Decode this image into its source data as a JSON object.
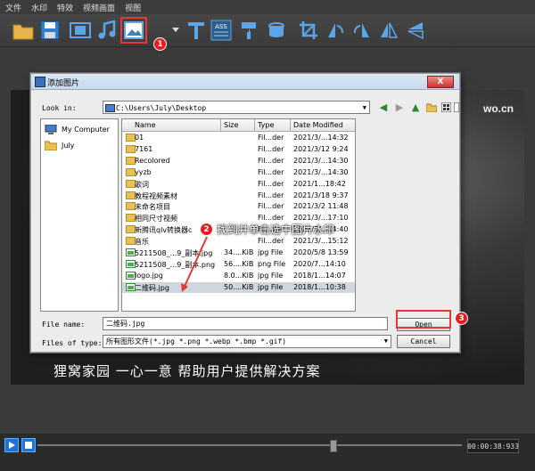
{
  "menu": [
    "文件",
    "水印",
    "特效",
    "视频画面",
    "视图"
  ],
  "toolbar": {
    "icons": [
      "folder-icon",
      "save-icon",
      "video-strip-icon",
      "music-icon",
      "image-icon",
      "dropdown-arrow-icon",
      "text-icon",
      "ass-subtitle-icon",
      "brush-icon",
      "bucket-icon",
      "crop-icon",
      "rotate-left-icon",
      "rotate-right-icon",
      "flip-horizontal-icon",
      "flip-vertical-icon"
    ],
    "ass_label": "ASS",
    "step1": "1"
  },
  "video": {
    "watermark": "wo.cn",
    "caption": "狸窝家园 一心一意 帮助用户提供解决方案"
  },
  "dialog": {
    "title": "添加图片",
    "close": "X",
    "look_in_label": "Look in:",
    "look_in_value": "C:\\Users\\July\\Desktop",
    "places": [
      "My Computer",
      "July"
    ],
    "columns": [
      "Name",
      "Size",
      "Type",
      "Date Modified"
    ],
    "files": [
      {
        "name": "01",
        "size": "",
        "type": "Fil...der",
        "date": "2021/3/...14:32",
        "kind": "folder"
      },
      {
        "name": "7161",
        "size": "",
        "type": "Fil...der",
        "date": "2021/3/12 9:24",
        "kind": "folder"
      },
      {
        "name": "Recolored",
        "size": "",
        "type": "Fil...der",
        "date": "2021/3/...14:30",
        "kind": "folder"
      },
      {
        "name": "yyzb",
        "size": "",
        "type": "Fil...der",
        "date": "2021/3/...14:30",
        "kind": "folder"
      },
      {
        "name": "歌词",
        "size": "",
        "type": "Fil...der",
        "date": "2021/1...18:42",
        "kind": "folder"
      },
      {
        "name": "教程视频素材",
        "size": "",
        "type": "Fil...der",
        "date": "2021/3/18 9:37",
        "kind": "folder"
      },
      {
        "name": "未命名项目",
        "size": "",
        "type": "Fil...der",
        "date": "2021/3/2 11:48",
        "kind": "folder"
      },
      {
        "name": "相同尺寸视频",
        "size": "",
        "type": "Fil...der",
        "date": "2021/3/...17:10",
        "kind": "folder"
      },
      {
        "name": "新腾讯qlv转换器c",
        "size": "",
        "type": "Fil...der",
        "date": "2021/3/...14:40",
        "kind": "folder"
      },
      {
        "name": "音乐",
        "size": "",
        "type": "Fil...der",
        "date": "2021/3/...15:12",
        "kind": "folder"
      },
      {
        "name": "5211508_...9_副本.jpg",
        "size": "34....KiB",
        "type": "jpg File",
        "date": "2020/5/8 13:59",
        "kind": "img"
      },
      {
        "name": "5211508_...9_副本.png",
        "size": "56....KiB",
        "type": "png File",
        "date": "2020/7...14:10",
        "kind": "img"
      },
      {
        "name": "logo.jpg",
        "size": "8.0...KiB",
        "type": "jpg File",
        "date": "2018/1...14:07",
        "kind": "img"
      },
      {
        "name": "二维码.jpg",
        "size": "50....KiB",
        "type": "jpg File",
        "date": "2018/1...10:38",
        "kind": "img",
        "selected": true
      }
    ],
    "file_name_label": "File name:",
    "file_name_value": "二维码.jpg",
    "files_of_type_label": "Files of type:",
    "files_of_type_value": "所有图形文件(*.jpg *.png *.webp *.bmp *.gif)",
    "open": "Open",
    "cancel": "Cancel"
  },
  "annotations": {
    "step2_num": "2",
    "step2_text": "找到并单击选中图片水印",
    "step3_num": "3"
  },
  "player": {
    "time": "00:00:38:933"
  },
  "colors": {
    "highlight": "#e53935",
    "accent_blue": "#1e73d8"
  }
}
